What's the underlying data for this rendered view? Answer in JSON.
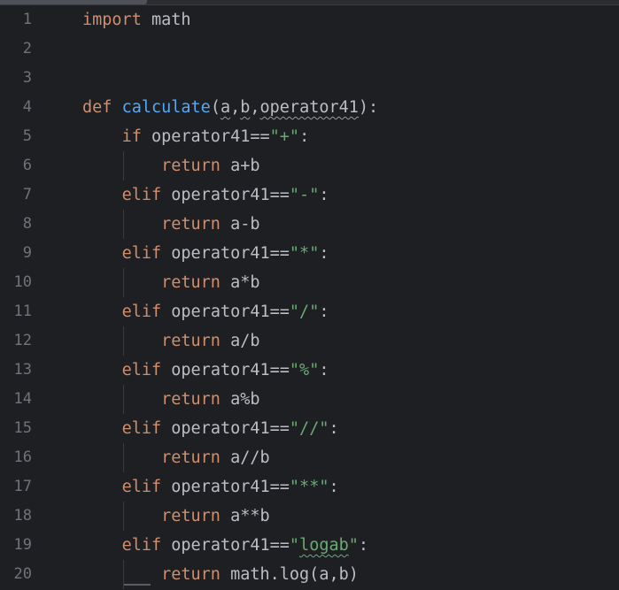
{
  "editor": {
    "line_numbers": [
      "1",
      "2",
      "3",
      "4",
      "5",
      "6",
      "7",
      "8",
      "9",
      "10",
      "11",
      "12",
      "13",
      "14",
      "15",
      "16",
      "17",
      "18",
      "19",
      "20"
    ],
    "lines": [
      {
        "tokens": [
          {
            "t": "import",
            "c": "kw"
          },
          {
            "t": " math",
            "c": "plain"
          }
        ]
      },
      {
        "tokens": []
      },
      {
        "tokens": []
      },
      {
        "tokens": [
          {
            "t": "def",
            "c": "kw"
          },
          {
            "t": " ",
            "c": "plain"
          },
          {
            "t": "calculate",
            "c": "fn"
          },
          {
            "t": "(",
            "c": "plain"
          },
          {
            "t": "a",
            "c": "plain",
            "w": "light"
          },
          {
            "t": ",",
            "c": "plain"
          },
          {
            "t": "b",
            "c": "plain",
            "w": "light"
          },
          {
            "t": ",",
            "c": "plain"
          },
          {
            "t": "operator41",
            "c": "plain",
            "w": "light"
          },
          {
            "t": "):",
            "c": "plain"
          }
        ]
      },
      {
        "tokens": [
          {
            "t": "    ",
            "c": "plain"
          },
          {
            "t": "if",
            "c": "kw"
          },
          {
            "t": " operator41==",
            "c": "plain"
          },
          {
            "t": "\"+\"",
            "c": "str"
          },
          {
            "t": ":",
            "c": "plain"
          }
        ]
      },
      {
        "guide": true,
        "tokens": [
          {
            "t": "        ",
            "c": "plain"
          },
          {
            "t": "return",
            "c": "kw"
          },
          {
            "t": " a+b",
            "c": "plain"
          }
        ]
      },
      {
        "tokens": [
          {
            "t": "    ",
            "c": "plain"
          },
          {
            "t": "elif",
            "c": "kw"
          },
          {
            "t": " operator41==",
            "c": "plain"
          },
          {
            "t": "\"-\"",
            "c": "str"
          },
          {
            "t": ":",
            "c": "plain"
          }
        ]
      },
      {
        "guide": true,
        "tokens": [
          {
            "t": "        ",
            "c": "plain"
          },
          {
            "t": "return",
            "c": "kw"
          },
          {
            "t": " a-b",
            "c": "plain"
          }
        ]
      },
      {
        "tokens": [
          {
            "t": "    ",
            "c": "plain"
          },
          {
            "t": "elif",
            "c": "kw"
          },
          {
            "t": " operator41==",
            "c": "plain"
          },
          {
            "t": "\"*\"",
            "c": "str"
          },
          {
            "t": ":",
            "c": "plain"
          }
        ]
      },
      {
        "guide": true,
        "tokens": [
          {
            "t": "        ",
            "c": "plain"
          },
          {
            "t": "return",
            "c": "kw"
          },
          {
            "t": " a*b",
            "c": "plain"
          }
        ]
      },
      {
        "tokens": [
          {
            "t": "    ",
            "c": "plain"
          },
          {
            "t": "elif",
            "c": "kw"
          },
          {
            "t": " operator41==",
            "c": "plain"
          },
          {
            "t": "\"/\"",
            "c": "str"
          },
          {
            "t": ":",
            "c": "plain"
          }
        ]
      },
      {
        "guide": true,
        "tokens": [
          {
            "t": "        ",
            "c": "plain"
          },
          {
            "t": "return",
            "c": "kw"
          },
          {
            "t": " a/b",
            "c": "plain"
          }
        ]
      },
      {
        "tokens": [
          {
            "t": "    ",
            "c": "plain"
          },
          {
            "t": "elif",
            "c": "kw"
          },
          {
            "t": " operator41==",
            "c": "plain"
          },
          {
            "t": "\"%\"",
            "c": "str"
          },
          {
            "t": ":",
            "c": "plain"
          }
        ]
      },
      {
        "guide": true,
        "tokens": [
          {
            "t": "        ",
            "c": "plain"
          },
          {
            "t": "return",
            "c": "kw"
          },
          {
            "t": " a%b",
            "c": "plain"
          }
        ]
      },
      {
        "tokens": [
          {
            "t": "    ",
            "c": "plain"
          },
          {
            "t": "elif",
            "c": "kw"
          },
          {
            "t": " operator41==",
            "c": "plain"
          },
          {
            "t": "\"//\"",
            "c": "str"
          },
          {
            "t": ":",
            "c": "plain"
          }
        ]
      },
      {
        "guide": true,
        "tokens": [
          {
            "t": "        ",
            "c": "plain"
          },
          {
            "t": "return",
            "c": "kw"
          },
          {
            "t": " a//b",
            "c": "plain"
          }
        ]
      },
      {
        "tokens": [
          {
            "t": "    ",
            "c": "plain"
          },
          {
            "t": "elif",
            "c": "kw"
          },
          {
            "t": " operator41==",
            "c": "plain"
          },
          {
            "t": "\"**\"",
            "c": "str"
          },
          {
            "t": ":",
            "c": "plain"
          }
        ]
      },
      {
        "guide": true,
        "tokens": [
          {
            "t": "        ",
            "c": "plain"
          },
          {
            "t": "return",
            "c": "kw"
          },
          {
            "t": " a**b",
            "c": "plain"
          }
        ]
      },
      {
        "tokens": [
          {
            "t": "    ",
            "c": "plain"
          },
          {
            "t": "elif",
            "c": "kw"
          },
          {
            "t": " operator41==",
            "c": "plain"
          },
          {
            "t": "\"",
            "c": "str"
          },
          {
            "t": "logab",
            "c": "str",
            "w": "green"
          },
          {
            "t": "\"",
            "c": "str"
          },
          {
            "t": ":",
            "c": "plain"
          }
        ]
      },
      {
        "guide": true,
        "tokens": [
          {
            "t": "        ",
            "c": "plain"
          },
          {
            "t": "return",
            "c": "kw"
          },
          {
            "t": " math.log(a,b)",
            "c": "plain"
          }
        ]
      }
    ]
  },
  "colors": {
    "background": "#1e1f22",
    "keyword": "#cf8e6d",
    "function": "#56a8f5",
    "string": "#6aab73",
    "text": "#bcbec4",
    "line_number": "#6f737a"
  }
}
